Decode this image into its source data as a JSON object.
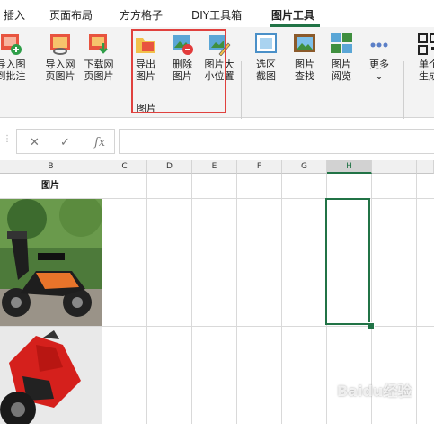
{
  "tabs": [
    {
      "label": "插入"
    },
    {
      "label": "页面布局"
    },
    {
      "label": "方方格子"
    },
    {
      "label": "DIY工具箱"
    },
    {
      "label": "图片工具"
    }
  ],
  "ribbon": {
    "buttons": [
      {
        "line1": "导入图",
        "line2": "到批注",
        "icon": "import-to-comment-icon"
      },
      {
        "line1": "导入网",
        "line2": "页图片",
        "icon": "import-web-image-icon"
      },
      {
        "line1": "下载网",
        "line2": "页图片",
        "icon": "download-web-image-icon"
      },
      {
        "line1": "导出",
        "line2": "图片",
        "icon": "export-image-icon"
      },
      {
        "line1": "删除",
        "line2": "图片",
        "icon": "delete-image-icon"
      },
      {
        "line1": "图片大",
        "line2": "小位置",
        "icon": "image-size-position-icon"
      },
      {
        "line1": "选区",
        "line2": "截图",
        "icon": "selection-screenshot-icon"
      },
      {
        "line1": "图片",
        "line2": "查找",
        "icon": "image-find-icon"
      },
      {
        "line1": "图片",
        "line2": "阅览",
        "icon": "image-view-icon"
      },
      {
        "line1": "更多",
        "line2": "⌄",
        "icon": "more-dots-icon"
      },
      {
        "line1": "单个",
        "line2": "生成",
        "icon": "qr-code-icon"
      }
    ],
    "group_label": "图片"
  },
  "formula_bar": {
    "cancel": "✕",
    "confirm": "✓",
    "fx": "fx",
    "value": ""
  },
  "sheet": {
    "columns": [
      "B",
      "C",
      "D",
      "E",
      "F",
      "G",
      "H",
      "I"
    ],
    "selected_column": "H",
    "header_cell": "图片",
    "watermark": "Baidu经验"
  },
  "colors": {
    "accent": "#217346",
    "highlight_box": "#e0413e"
  }
}
